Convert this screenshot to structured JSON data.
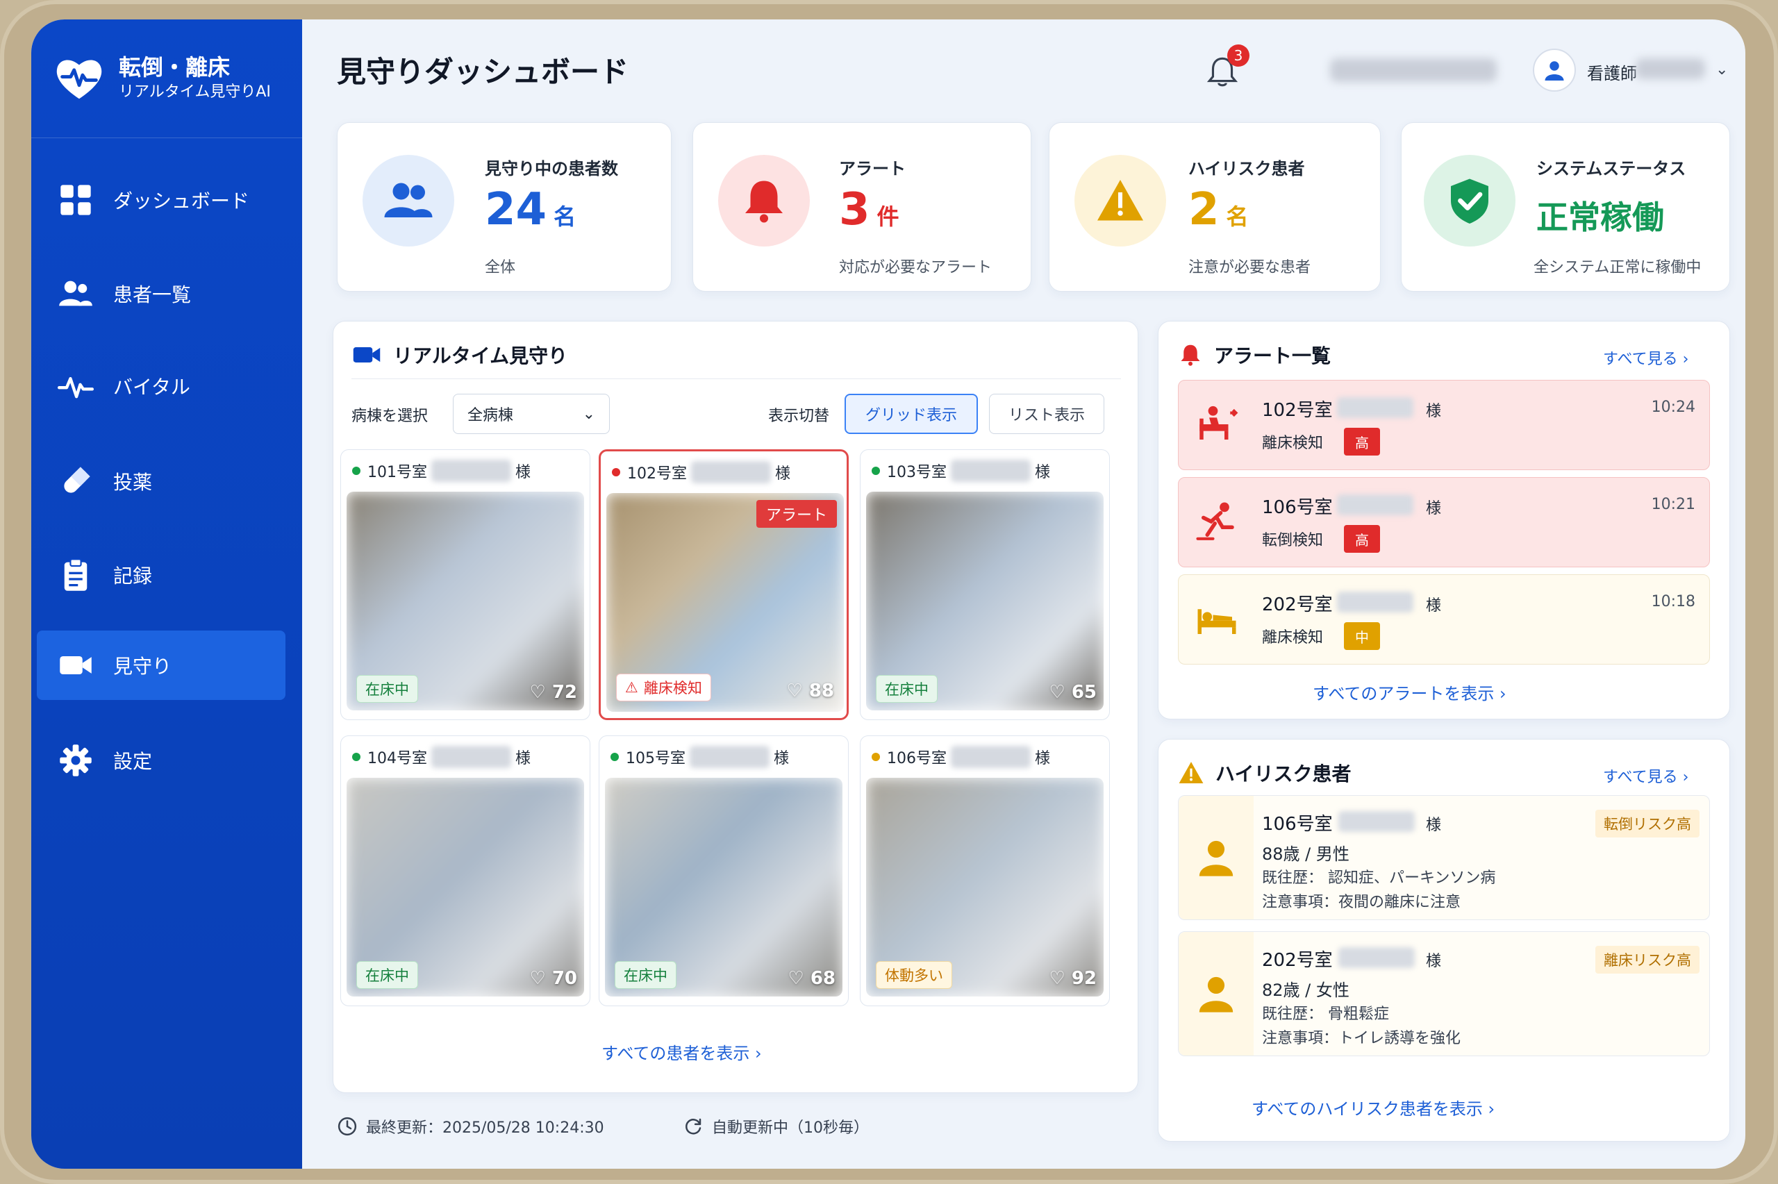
{
  "app": {
    "title_line1": "転倒・離床",
    "title_line2": "リアルタイム見守りAI"
  },
  "sidebar": {
    "items": [
      {
        "label": "ダッシュボード",
        "icon": "grid-icon"
      },
      {
        "label": "患者一覧",
        "icon": "users-icon"
      },
      {
        "label": "バイタル",
        "icon": "pulse-icon"
      },
      {
        "label": "投薬",
        "icon": "pill-icon"
      },
      {
        "label": "記録",
        "icon": "clipboard-icon"
      },
      {
        "label": "見守り",
        "icon": "video-icon",
        "active": true
      },
      {
        "label": "設定",
        "icon": "gear-icon"
      }
    ]
  },
  "header": {
    "title": "見守りダッシュボード",
    "notification_count": "3",
    "user_role": "看護師"
  },
  "stats": [
    {
      "label": "見守り中の患者数",
      "value": "24",
      "unit": "名",
      "sub": "全体",
      "color": "#1d5fd6"
    },
    {
      "label": "アラート",
      "value": "3",
      "unit": "件",
      "sub": "対応が必要なアラート",
      "color": "#e02b2b"
    },
    {
      "label": "ハイリスク患者",
      "value": "2",
      "unit": "名",
      "sub": "注意が必要な患者",
      "color": "#e0a100"
    },
    {
      "label": "システムステータス",
      "value": "正常稼働",
      "unit": "",
      "sub": "全システム正常に稼働中",
      "color": "#159957"
    }
  ],
  "monitor": {
    "title": "リアルタイム見守り",
    "ward_label": "病棟を選択",
    "ward_value": "全病棟",
    "view_label": "表示切替",
    "grid_btn": "グリッド表示",
    "list_btn": "リスト表示",
    "show_all": "すべての患者を表示",
    "sama": "様",
    "alert_tag": "アラート",
    "cameras": [
      {
        "room": "101号室",
        "status": "在床中",
        "hr": "72",
        "dot": "#16a34a",
        "status_color": "green"
      },
      {
        "room": "102号室",
        "status": "離床検知",
        "hr": "88",
        "dot": "#e02b2b",
        "status_color": "red",
        "alert": true
      },
      {
        "room": "103号室",
        "status": "在床中",
        "hr": "65",
        "dot": "#16a34a",
        "status_color": "green"
      },
      {
        "room": "104号室",
        "status": "在床中",
        "hr": "70",
        "dot": "#16a34a",
        "status_color": "green"
      },
      {
        "room": "105号室",
        "status": "在床中",
        "hr": "68",
        "dot": "#16a34a",
        "status_color": "green"
      },
      {
        "room": "106号室",
        "status": "体動多い",
        "hr": "92",
        "dot": "#e0a100",
        "status_color": "orange"
      }
    ]
  },
  "alerts": {
    "title": "アラート一覧",
    "see_all": "すべて見る",
    "show_all": "すべてのアラートを表示",
    "items": [
      {
        "room": "102号室",
        "type": "離床検知",
        "level": "高",
        "time": "10:24",
        "sama": "様"
      },
      {
        "room": "106号室",
        "type": "転倒検知",
        "level": "高",
        "time": "10:21",
        "sama": "様"
      },
      {
        "room": "202号室",
        "type": "離床検知",
        "level": "中",
        "time": "10:18",
        "sama": "様"
      }
    ]
  },
  "highrisk": {
    "title": "ハイリスク患者",
    "see_all": "すべて見る",
    "show_all": "すべてのハイリスク患者を表示",
    "items": [
      {
        "room": "106号室",
        "sama": "様",
        "age": "88歳 / 男性",
        "history": "既往歴： 認知症、パーキンソン病",
        "note": "注意事項：夜間の離床に注意",
        "tag": "転倒リスク高"
      },
      {
        "room": "202号室",
        "sama": "様",
        "age": "82歳 / 女性",
        "history": "既往歴： 骨粗鬆症",
        "note": "注意事項：トイレ誘導を強化",
        "tag": "離床リスク高"
      }
    ]
  },
  "footer": {
    "last_update": "最終更新：2025/05/28 10:24:30",
    "auto_update": "自動更新中（10秒毎）"
  }
}
